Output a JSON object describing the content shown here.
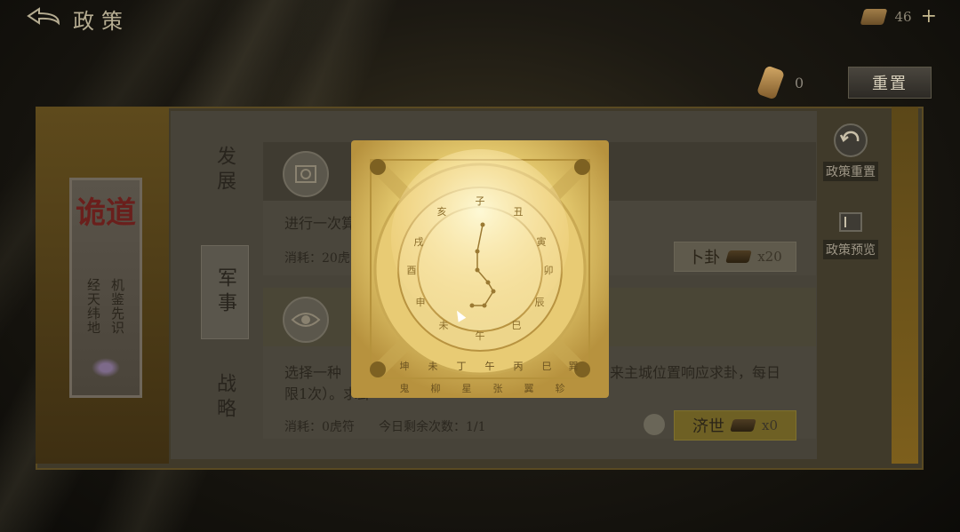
{
  "header": {
    "title": "政策",
    "currency_value": "46",
    "plus": "+"
  },
  "token": {
    "count": "0"
  },
  "reset": {
    "label": "重置"
  },
  "book": {
    "title": "诡道",
    "subtitle_cols": [
      "机鉴先识",
      "经天纬地"
    ]
  },
  "tabs": [
    {
      "label": "发展"
    },
    {
      "label": "军事"
    },
    {
      "label": "战略"
    }
  ],
  "cards": [
    {
      "desc": "进行一次算",
      "cost": "消耗：20虎",
      "button": {
        "label": "卜卦",
        "count": "x20"
      }
    },
    {
      "desc": "选择一种",
      "desc_right": "来主城位置响应求卦，每日",
      "desc_line2": "限1次）。求卦",
      "cost": "消耗：0虎符",
      "remaining": "今日剩余次数：1/1",
      "button": {
        "label": "济世",
        "count": "x0"
      }
    }
  ],
  "side": {
    "reset_label": "政策重置",
    "preview_label": "政策预览"
  },
  "compass": {
    "outer_glyphs_top": [
      "坤",
      "未",
      "丁",
      "午",
      "丙",
      "巳",
      "巽"
    ],
    "outer_glyphs_bottom": [
      "鬼",
      "柳",
      "星",
      "张",
      "翼",
      "轸"
    ],
    "ring_glyphs": [
      "子",
      "丑",
      "寅",
      "卯",
      "辰",
      "巳",
      "午",
      "未",
      "申",
      "酉",
      "戌",
      "亥"
    ]
  },
  "colors": {
    "gold": "#f6e7a4",
    "glow": "#fff6c4"
  }
}
